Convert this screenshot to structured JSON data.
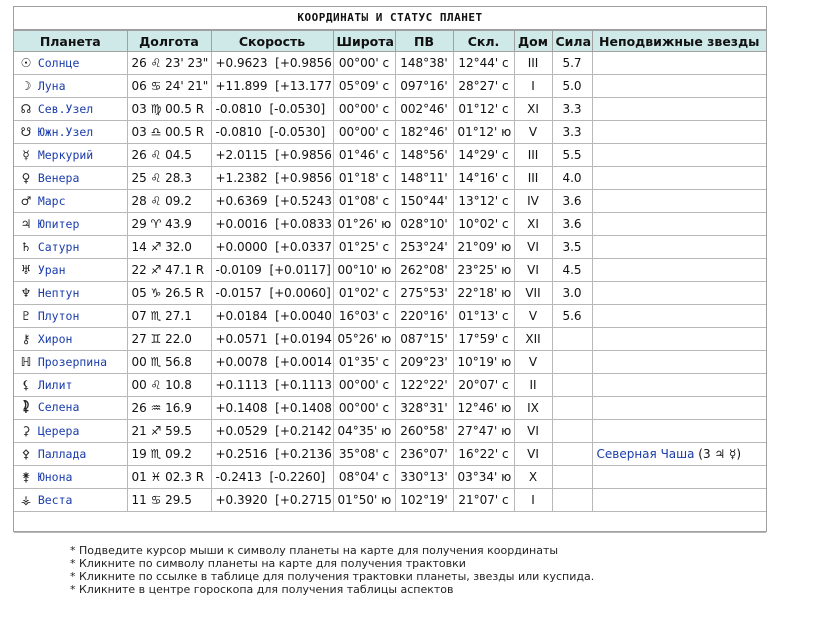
{
  "title": "КООРДИНАТЫ И СТАТУС ПЛАНЕТ",
  "columns": [
    "Планета",
    "Долгота",
    "Скорость",
    "Широта",
    "ПВ",
    "Скл.",
    "Дом",
    "Сила",
    "Неподвижные звезды"
  ],
  "rows": [
    {
      "sym": "☉",
      "icon": "sun-icon",
      "name": "Солнце",
      "lon": "26 ♌ 23' 23\"",
      "speed": "+0.9623  [+0.9856]",
      "lat": "00°00' с",
      "ra": "148°38'",
      "decl": "12°44' с",
      "house": "III",
      "strength": "5.7",
      "stars": ""
    },
    {
      "sym": "☽",
      "icon": "moon-icon",
      "name": "Луна",
      "lon": "06 ♋ 24' 21\"",
      "speed": "+11.899  [+13.177]",
      "lat": "05°09' с",
      "ra": "097°16'",
      "decl": "28°27' с",
      "house": "I",
      "strength": "5.0",
      "stars": ""
    },
    {
      "sym": "☊",
      "icon": "north-node-icon",
      "name": "Сев.Узел",
      "lon": "03 ♍ 00.5  R",
      "speed": "-0.0810  [-0.0530]",
      "lat": "00°00' с",
      "ra": "002°46'",
      "decl": "01°12' с",
      "house": "XI",
      "strength": "3.3",
      "stars": ""
    },
    {
      "sym": "☋",
      "icon": "south-node-icon",
      "name": "Южн.Узел",
      "lon": "03 ♎ 00.5  R",
      "speed": "-0.0810  [-0.0530]",
      "lat": "00°00' с",
      "ra": "182°46'",
      "decl": "01°12' ю",
      "house": "V",
      "strength": "3.3",
      "stars": ""
    },
    {
      "sym": "☿",
      "icon": "mercury-icon",
      "name": "Меркурий",
      "lon": "26 ♌ 04.5",
      "speed": "+2.0115  [+0.9856]",
      "lat": "01°46' с",
      "ra": "148°56'",
      "decl": "14°29' с",
      "house": "III",
      "strength": "5.5",
      "stars": ""
    },
    {
      "sym": "♀",
      "icon": "venus-icon",
      "name": "Венера",
      "lon": "25 ♌ 28.3",
      "speed": "+1.2382  [+0.9856]",
      "lat": "01°18' с",
      "ra": "148°11'",
      "decl": "14°16' с",
      "house": "III",
      "strength": "4.0",
      "stars": ""
    },
    {
      "sym": "♂",
      "icon": "mars-icon",
      "name": "Марс",
      "lon": "28 ♌ 09.2",
      "speed": "+0.6369  [+0.5243]",
      "lat": "01°08' с",
      "ra": "150°44'",
      "decl": "13°12' с",
      "house": "IV",
      "strength": "3.6",
      "stars": ""
    },
    {
      "sym": "♃",
      "icon": "jupiter-icon",
      "name": "Юпитер",
      "lon": "29 ♈ 43.9",
      "speed": "+0.0016  [+0.0833]",
      "lat": "01°26' ю",
      "ra": "028°10'",
      "decl": "10°02' с",
      "house": "XI",
      "strength": "3.6",
      "stars": ""
    },
    {
      "sym": "♄",
      "icon": "saturn-icon",
      "name": "Сатурн",
      "lon": "14 ♐ 32.0",
      "speed": "+0.0000  [+0.0337]",
      "lat": "01°25' с",
      "ra": "253°24'",
      "decl": "21°09' ю",
      "house": "VI",
      "strength": "3.5",
      "stars": ""
    },
    {
      "sym": "♅",
      "icon": "uranus-icon",
      "name": "Уран",
      "lon": "22 ♐ 47.1  R",
      "speed": "-0.0109  [+0.0117]",
      "lat": "00°10' ю",
      "ra": "262°08'",
      "decl": "23°25' ю",
      "house": "VI",
      "strength": "4.5",
      "stars": ""
    },
    {
      "sym": "♆",
      "icon": "neptune-icon",
      "name": "Нептун",
      "lon": "05 ♑ 26.5  R",
      "speed": "-0.0157  [+0.0060]",
      "lat": "01°02' с",
      "ra": "275°53'",
      "decl": "22°18' ю",
      "house": "VII",
      "strength": "3.0",
      "stars": ""
    },
    {
      "sym": "♇",
      "icon": "pluto-icon",
      "name": "Плутон",
      "lon": "07 ♏ 27.1",
      "speed": "+0.0184  [+0.0040]",
      "lat": "16°03' с",
      "ra": "220°16'",
      "decl": "01°13' с",
      "house": "V",
      "strength": "5.6",
      "stars": ""
    },
    {
      "sym": "⚷",
      "icon": "chiron-icon",
      "name": "Хирон",
      "lon": "27 ♊ 22.0",
      "speed": "+0.0571  [+0.0194]",
      "lat": "05°26' ю",
      "ra": "087°15'",
      "decl": "17°59' с",
      "house": "XII",
      "strength": "",
      "stars": ""
    },
    {
      "sym": "ℍ",
      "icon": "proserpina-icon",
      "name": "Прозерпина",
      "lon": "00 ♏ 56.8",
      "speed": "+0.0078  [+0.0014]",
      "lat": "01°35' с",
      "ra": "209°23'",
      "decl": "10°19' ю",
      "house": "V",
      "strength": "",
      "stars": ""
    },
    {
      "sym": "⚸",
      "icon": "lilith-icon",
      "name": "Лилит",
      "lon": "00 ♌ 10.8",
      "speed": "+0.1113  [+0.1113]",
      "lat": "00°00' с",
      "ra": "122°22'",
      "decl": "20°07' с",
      "house": "II",
      "strength": "",
      "stars": ""
    },
    {
      "sym": "⯝",
      "icon": "selena-icon",
      "name": "Селена",
      "lon": "26 ♒ 16.9",
      "speed": "+0.1408  [+0.1408]",
      "lat": "00°00' с",
      "ra": "328°31'",
      "decl": "12°46' ю",
      "house": "IX",
      "strength": "",
      "stars": ""
    },
    {
      "sym": "⚳",
      "icon": "ceres-icon",
      "name": "Церера",
      "lon": "21 ♐ 59.5",
      "speed": "+0.0529  [+0.2142]",
      "lat": "04°35' ю",
      "ra": "260°58'",
      "decl": "27°47' ю",
      "house": "VI",
      "strength": "",
      "stars": ""
    },
    {
      "sym": "⚴",
      "icon": "pallas-icon",
      "name": "Паллада",
      "lon": "19 ♏ 09.2",
      "speed": "+0.2516  [+0.2136]",
      "lat": "35°08' с",
      "ra": "236°07'",
      "decl": "16°22' с",
      "house": "VI",
      "strength": "",
      "stars": "Северная Чаша",
      "stars_suffix": " (3 ♃ ☿)"
    },
    {
      "sym": "⚵",
      "icon": "juno-icon",
      "name": "Юнона",
      "lon": "01 ♓ 02.3  R",
      "speed": "-0.2413  [-0.2260]",
      "lat": "08°04' с",
      "ra": "330°13'",
      "decl": "03°34' ю",
      "house": "X",
      "strength": "",
      "stars": ""
    },
    {
      "sym": "⚶",
      "icon": "vesta-icon",
      "name": "Веста",
      "lon": "11 ♋ 29.5",
      "speed": "+0.3920  [+0.2715]",
      "lat": "01°50' ю",
      "ra": "102°19'",
      "decl": "21°07' с",
      "house": "I",
      "strength": "",
      "stars": ""
    }
  ],
  "notes": [
    "* Подведите курсор мыши к символу планеты на карте для получения координаты",
    "* Кликните по символу планеты на карте для получения трактовки",
    "* Кликните по ссылке в таблице для получения трактовки планеты, звезды или куспида.",
    "* Кликните в центре гороскопа для получения таблицы аспектов"
  ],
  "colors": {
    "header_bg": "#cfe9e9",
    "link": "#1a3caa",
    "border": "#a0a0a0"
  }
}
